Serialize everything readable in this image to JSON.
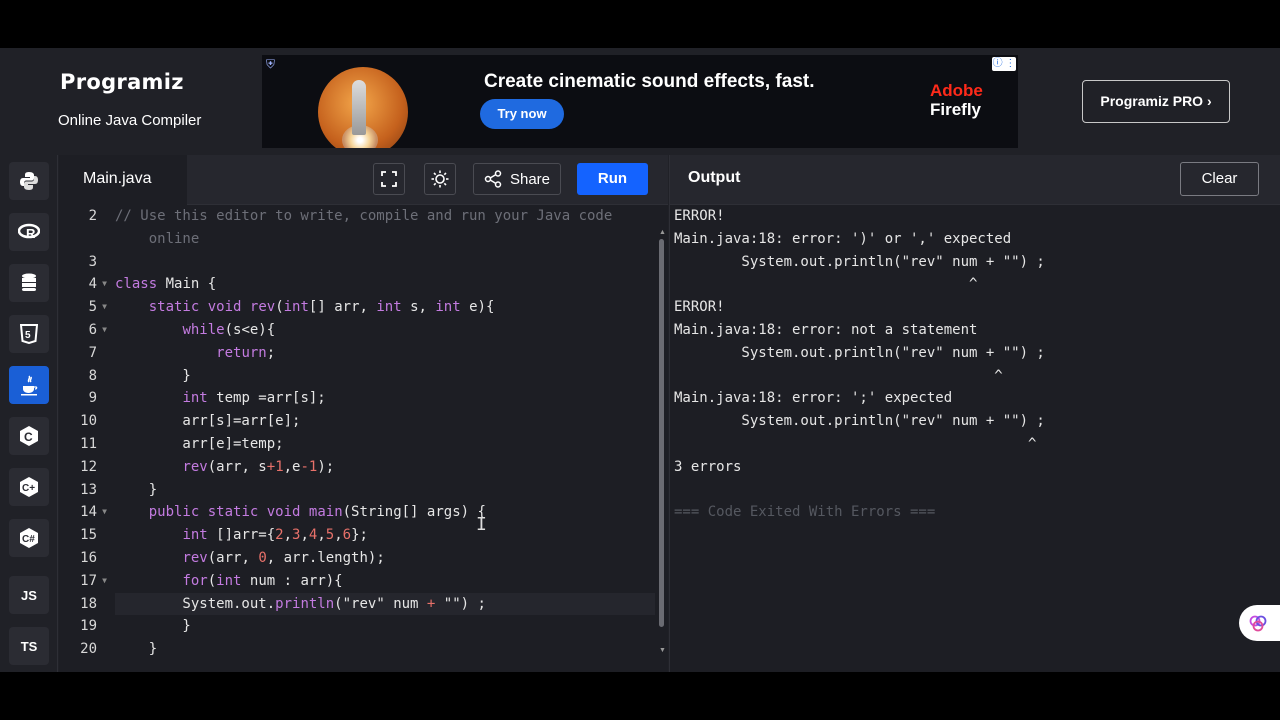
{
  "header": {
    "logo": "Programiz",
    "subtitle": "Online Java Compiler",
    "pro_button": "Programiz PRO ›",
    "ad": {
      "title": "Create cinematic sound effects, fast.",
      "cta": "Try now",
      "brand_line1": "Adobe",
      "brand_line2": "Firefly"
    }
  },
  "sidebar": {
    "items": [
      {
        "icon": "python-icon",
        "label": ""
      },
      {
        "icon": "r-icon",
        "label": ""
      },
      {
        "icon": "sql-database-icon",
        "label": ""
      },
      {
        "icon": "html5-icon",
        "label": ""
      },
      {
        "icon": "java-icon",
        "label": "",
        "active": true
      },
      {
        "icon": "c-icon",
        "label": ""
      },
      {
        "icon": "cplusplus-icon",
        "label": ""
      },
      {
        "icon": "csharp-icon",
        "label": ""
      },
      {
        "icon": "javascript-icon",
        "label": "JS"
      },
      {
        "icon": "typescript-icon",
        "label": "TS"
      }
    ]
  },
  "editor": {
    "tab_name": "Main.java",
    "share_label": "Share",
    "run_label": "Run",
    "line_numbers": [
      "2",
      "",
      "3",
      "4",
      "5",
      "6",
      "7",
      "8",
      "9",
      "10",
      "11",
      "12",
      "13",
      "14",
      "15",
      "16",
      "17",
      "18",
      "19",
      "20"
    ]
  },
  "output": {
    "title": "Output",
    "clear_label": "Clear",
    "lines": [
      "ERROR!",
      "Main.java:18: error: ')' or ',' expected",
      "        System.out.println(\"rev\" num + \"\") ;",
      "                                   ^",
      "ERROR!",
      "Main.java:18: error: not a statement",
      "        System.out.println(\"rev\" num + \"\") ;",
      "                                      ^",
      "Main.java:18: error: ';' expected",
      "        System.out.println(\"rev\" num + \"\") ;",
      "                                          ^",
      "3 errors",
      "",
      "=== Code Exited With Errors ==="
    ]
  },
  "colors": {
    "accent": "#1463ff",
    "background": "#1d1e24",
    "keyword": "#c37be0",
    "number": "#e8716a",
    "comment": "#6d6f78"
  }
}
